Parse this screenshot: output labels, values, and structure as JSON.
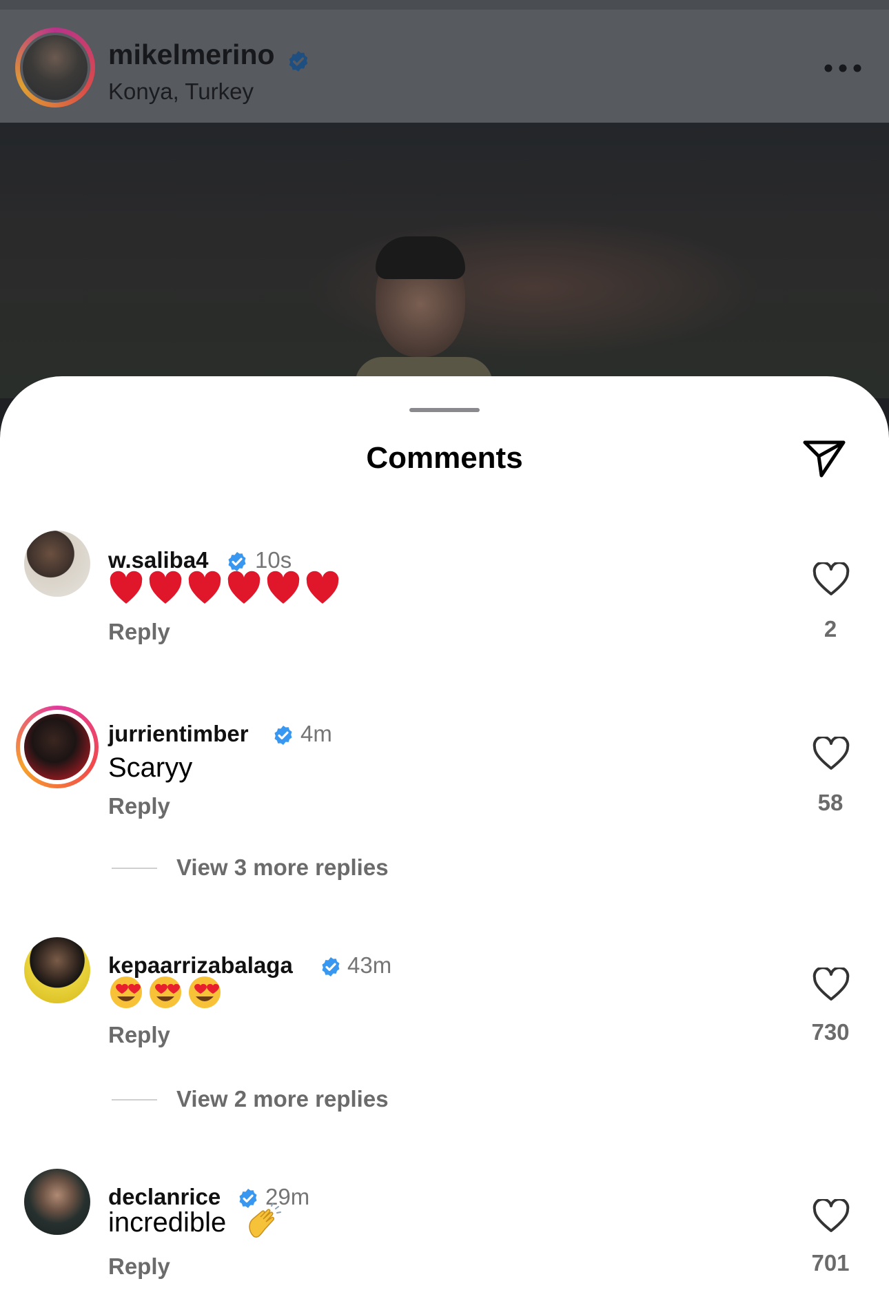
{
  "post_header": {
    "username": "mikelmerino",
    "location": "Konya, Turkey",
    "verified": true
  },
  "sheet": {
    "title": "Comments"
  },
  "comments": [
    {
      "username": "w.saliba4",
      "time": "10s",
      "text": "",
      "emoji": "red-heart-x6",
      "reply_label": "Reply",
      "likes": "2",
      "verified": true
    },
    {
      "username": "jurrientimber",
      "time": "4m",
      "text": "Scaryy",
      "reply_label": "Reply",
      "likes": "58",
      "verified": true,
      "view_more": "View 3 more replies"
    },
    {
      "username": "kepaarrizabalaga",
      "time": "43m",
      "text": "",
      "emoji": "heart-eyes-x3",
      "reply_label": "Reply",
      "likes": "730",
      "verified": true,
      "view_more": "View 2 more replies"
    },
    {
      "username": "declanrice",
      "time": "29m",
      "text": "incredible",
      "emoji": "clapping-hands",
      "reply_label": "Reply",
      "likes": "701",
      "verified": true
    }
  ],
  "colors": {
    "verified_blue": "#3897f0",
    "story_ring": "#e23b9c",
    "secondary_text": "#6b6b6b"
  }
}
